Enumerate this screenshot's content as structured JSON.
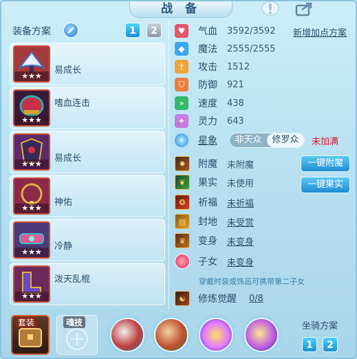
{
  "header": {
    "title": "战 备"
  },
  "equip": {
    "title": "装备方案",
    "plan_buttons": [
      "1",
      "2"
    ],
    "items": [
      {
        "name": "易成长",
        "stars": "★★★"
      },
      {
        "name": "嗜血连击",
        "stars": "★★★"
      },
      {
        "name": "易成长",
        "stars": "★★★"
      },
      {
        "name": "神佑",
        "stars": "★★★"
      },
      {
        "name": "冷静",
        "stars": "★★★"
      },
      {
        "name": "泼天乱棍",
        "stars": "★★★"
      }
    ]
  },
  "stats": {
    "add_plan": "新增加点方案",
    "rows": [
      {
        "label": "气血",
        "value": "3592/3592",
        "icon": "heart-icon",
        "color": "#e4546a"
      },
      {
        "label": "魔法",
        "value": "2555/2555",
        "icon": "mana-diamond-icon",
        "color": "#3ea7ea"
      },
      {
        "label": "攻击",
        "value": "1512",
        "icon": "sword-icon",
        "color": "#f0a23c"
      },
      {
        "label": "防御",
        "value": "921",
        "icon": "shield-icon",
        "color": "#ec7f3c"
      },
      {
        "label": "速度",
        "value": "438",
        "icon": "speed-icon",
        "color": "#36b86a"
      },
      {
        "label": "灵力",
        "value": "643",
        "icon": "spirit-icon",
        "color": "#c77ae0"
      }
    ],
    "xingxiang": {
      "label": "星象",
      "options": [
        "非天众",
        "修罗众"
      ],
      "warning": "未加满"
    },
    "extra": [
      {
        "label": "附魔",
        "value": "未附魔",
        "underline": false
      },
      {
        "label": "果实",
        "value": "未使用",
        "underline": false
      },
      {
        "label": "祈福",
        "value": "未祈福",
        "underline": true
      },
      {
        "label": "封地",
        "value": "未受赏",
        "underline": true
      },
      {
        "label": "变身",
        "value": "未变身",
        "underline": true
      },
      {
        "label": "子女",
        "value": "未变身",
        "underline": true
      }
    ],
    "buttons": {
      "enchant": "一键附魔",
      "fruit": "一键果实"
    },
    "note": "穿戴时装或饰品可携带第二子女",
    "cultivation": {
      "label": "修炼觉醒",
      "value": "0/8"
    }
  },
  "bottom": {
    "suit_label": "套装",
    "soul_label": "魂技",
    "mount_title": "坐骑方案",
    "mount_buttons": [
      "1",
      "2"
    ]
  }
}
